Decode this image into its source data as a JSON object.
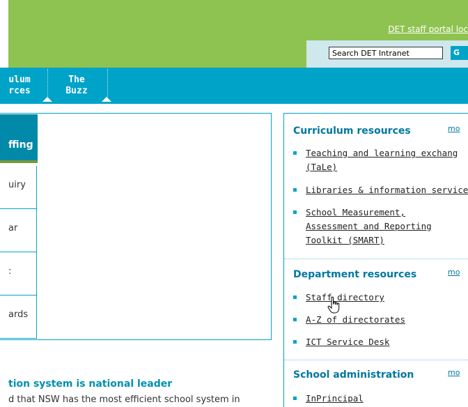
{
  "header": {
    "portal_link": "DET staff portal loc",
    "search_placeholder": "Search DET Intranet",
    "go_label": "G"
  },
  "nav": {
    "items": [
      {
        "line1": "ulum",
        "line2": "rces"
      },
      {
        "line1": "The",
        "line2": "Buzz"
      }
    ]
  },
  "left": {
    "active_tab": "ffing",
    "tabs": [
      "uiry",
      "ar",
      ":",
      "ards"
    ],
    "news_title": "tion system is national leader",
    "news_text": "d that NSW has the most efficient school system in"
  },
  "right": {
    "sections": [
      {
        "title": "Curriculum resources",
        "more": "mo",
        "links": [
          [
            "Teaching and learning exchang",
            "(TaLe)"
          ],
          [
            "Libraries & information services"
          ],
          [
            "School Measurement,",
            "Assessment and Reporting",
            "Toolkit (SMART)"
          ]
        ]
      },
      {
        "title": "Department resources",
        "more": "mo",
        "links": [
          [
            "Staff directory"
          ],
          [
            "A-Z of directorates"
          ],
          [
            "ICT Service Desk"
          ]
        ]
      },
      {
        "title": "School administration",
        "more": "mo",
        "links": [
          [
            "InPrincipal"
          ]
        ]
      }
    ]
  },
  "colors": {
    "header_green": "#8fc351",
    "nav_teal": "#00a3c8",
    "heading_blue": "#0077a0"
  }
}
